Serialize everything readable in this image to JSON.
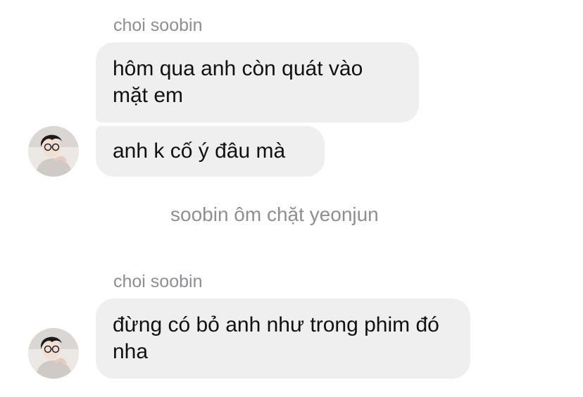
{
  "groups": [
    {
      "sender": "choi soobin",
      "messages": [
        "hôm qua anh còn quát vào mặt em",
        "anh k cố ý đâu mà"
      ]
    },
    {
      "sender": "choi soobin",
      "messages": [
        "đừng có bỏ anh như trong phim đó nha"
      ]
    }
  ],
  "system_note": "soobin ôm chặt yeonjun",
  "avatar": {
    "icon": "profile-photo-avatar"
  },
  "colors": {
    "bubble": "#efefef",
    "meta_text": "#8e8e93",
    "message_text": "#111111"
  }
}
